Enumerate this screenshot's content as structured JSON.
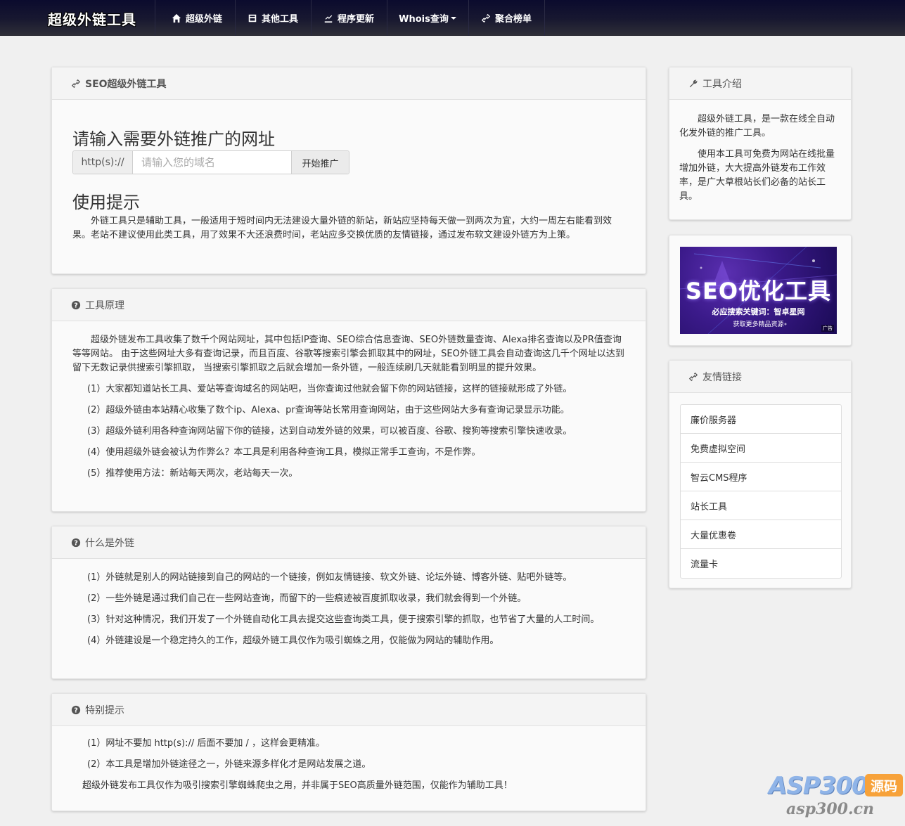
{
  "nav": {
    "brand": "超级外链工具",
    "items": [
      {
        "label": "超级外链",
        "icon": "home-icon"
      },
      {
        "label": "其他工具",
        "icon": "box-icon"
      },
      {
        "label": "程序更新",
        "icon": "upload-icon"
      },
      {
        "label": "Whois查询",
        "icon": "none"
      },
      {
        "label": "聚合榜单",
        "icon": "link-icon"
      }
    ]
  },
  "main": {
    "panel1": {
      "heading": "SEO超级外链工具",
      "prompt": "请输入需要外链推广的网址",
      "addon": "http(s)://",
      "placeholder": "请输入您的域名",
      "button": "开始推广",
      "tips_title": "使用提示",
      "tips_text": "外链工具只是辅助工具，一般适用于短时间内无法建设大量外链的新站，新站应坚持每天做一到两次为宜，大约一周左右能看到效果。老站不建议使用此类工具，用了效果不大还浪费时间，老站应多交换优质的友情链接，通过发布软文建设外链方为上策。"
    },
    "panel2": {
      "heading": "工具原理",
      "intro": "超级外链发布工具收集了数千个网站网址，其中包括IP查询、SEO综合信息查询、SEO外链数量查询、Alexa排名查询以及PR值查询等等网站。 由于这些网址大多有查询记录，而且百度、谷歌等搜索引擎会抓取其中的网址，SEO外链工具会自动查询这几千个网址以达到留下无数记录供搜索引擎抓取， 当搜索引擎抓取之后就会增加一条外链，一般连续刷几天就能看到明显的提升效果。",
      "items": [
        "(1）大家都知道站长工具、爱站等查询域名的网站吧，当你查询过他就会留下你的网站链接，这样的链接就形成了外链。",
        "(2）超级外链由本站精心收集了数个ip、Alexa、pr查询等站长常用查询网站，由于这些网站大多有查询记录显示功能。",
        "(3）超级外链利用各种查询网站留下你的链接，达到自动发外链的效果，可以被百度、谷歌、搜狗等搜索引擎快速收录。",
        "(4）使用超级外链会被认为作弊么？本工具是利用各种查询工具，模拟正常手工查询，不是作弊。",
        "(5）推荐使用方法：新站每天两次，老站每天一次。"
      ]
    },
    "panel3": {
      "heading": "什么是外链",
      "items": [
        "(1）外链就是别人的网站链接到自己的网站的一个链接，例如友情链接、软文外链、论坛外链、博客外链、贴吧外链等。",
        "(2）一些外链是通过我们自己在一些网站查询，而留下的一些痕迹被百度抓取收录，我们就会得到一个外链。",
        "(3）针对这种情况，我们开发了一个外链自动化工具去提交这些查询类工具，便于搜索引擎的抓取，也节省了大量的人工时间。",
        "(4）外链建设是一个稳定持久的工作，超级外链工具仅作为吸引蜘蛛之用，仅能做为网站的辅助作用。"
      ]
    },
    "panel4": {
      "heading": "特别提示",
      "items": [
        "(1）网址不要加 http(s):// 后面不要加 / ，这样会更精准。",
        "(2）本工具是增加外链途径之一，外链来源多样化才是网站发展之道。"
      ],
      "footer": "超级外链发布工具仅作为吸引搜索引擎蜘蛛爬虫之用，并非属于SEO高质量外链范围，仅能作为辅助工具！"
    }
  },
  "sidebar": {
    "intro": {
      "heading": "工具介绍",
      "paras": [
        "超级外链工具，是一款在线全自动化发外链的推广工具。",
        "使用本工具可免费为网站在线批量增加外链，大大提高外链发布工作效率，是广大草根站长们必备的站长工具。"
      ]
    },
    "ad": {
      "title": "SEO优化工具",
      "subtitle": "必应搜索关键词：智卓星网",
      "subtitle2": "获取更多精品资源",
      "tag": "广告"
    },
    "links": {
      "heading": "友情链接",
      "items": [
        "廉价服务器",
        "免费虚拟空间",
        "智云CMS程序",
        "站长工具",
        "大量优惠卷",
        "流量卡"
      ]
    }
  },
  "watermark": {
    "logo": "ASP300",
    "badge": "源码",
    "url": "asp300.cn"
  }
}
